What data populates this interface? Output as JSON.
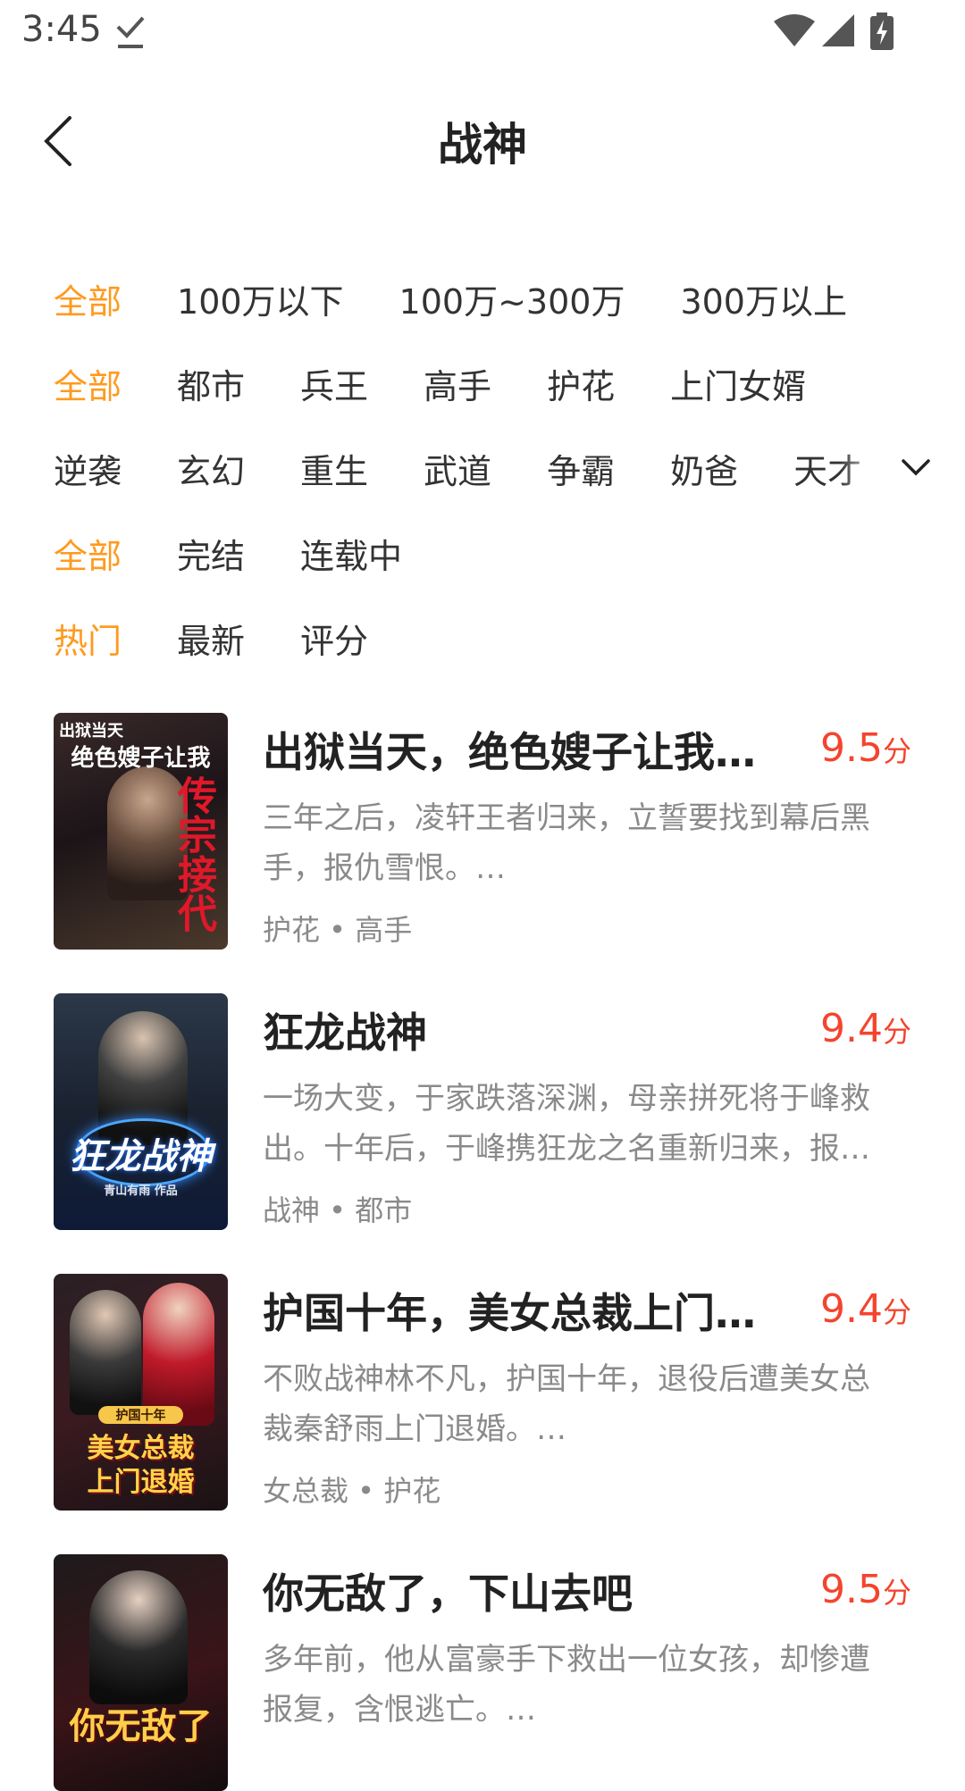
{
  "status_bar": {
    "time": "3:45"
  },
  "header": {
    "title": "战神"
  },
  "filters": {
    "wordcount": [
      "全部",
      "100万以下",
      "100万~300万",
      "300万以上"
    ],
    "genre1": [
      "全部",
      "都市",
      "兵王",
      "高手",
      "护花",
      "上门女婿"
    ],
    "genre2": [
      "逆袭",
      "玄幻",
      "重生",
      "武道",
      "争霸",
      "奶爸",
      "天才"
    ],
    "status": [
      "全部",
      "完结",
      "连载中"
    ],
    "sort": [
      "热门",
      "最新",
      "评分"
    ]
  },
  "books": [
    {
      "title": "出狱当天，绝色嫂子让我…",
      "score": "9.5",
      "unit": "分",
      "desc_line1": "三年之后，凌轩王者归来，立誓要找到幕后黑",
      "desc_line2": "手，报仇雪恨。…",
      "tags": "护花 • 高手",
      "cover": {
        "line1": "出狱当天",
        "line2": "绝色嫂子让我",
        "line3": "传宗接代"
      }
    },
    {
      "title": "狂龙战神",
      "score": "9.4",
      "unit": "分",
      "desc_line1": "一场大变，于家跌落深渊，母亲拼死将于峰救",
      "desc_line2": "出。十年后，于峰携狂龙之名重新归来，报…",
      "tags": "战神 • 都市",
      "cover": {
        "line1": "狂龙战神",
        "line2": "青山有雨 作品"
      }
    },
    {
      "title": "护国十年，美女总裁上门…",
      "score": "9.4",
      "unit": "分",
      "desc_line1": "不败战神林不凡，护国十年，退役后遭美女总",
      "desc_line2": "裁秦舒雨上门退婚。…",
      "tags": "女总裁 • 护花",
      "cover": {
        "line1": "护国十年",
        "line2": "美女总裁",
        "line3": "上门退婚"
      }
    },
    {
      "title": "你无敌了，下山去吧",
      "score": "9.5",
      "unit": "分",
      "desc_line1": "多年前，他从富豪手下救出一位女孩，却惨遭",
      "desc_line2": "报复，含恨逃亡。…",
      "tags": "",
      "cover": {
        "line1": "你无敌了"
      }
    }
  ],
  "colors": {
    "accent": "#ff9a1f",
    "score": "#f4442e",
    "muted": "#8a8a8a"
  }
}
